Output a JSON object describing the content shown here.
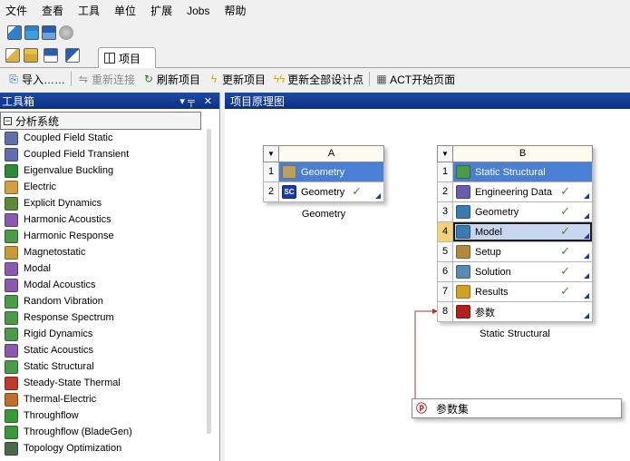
{
  "menubar": [
    "文件",
    "查看",
    "工具",
    "单位",
    "扩展",
    "Jobs",
    "帮助"
  ],
  "toolbar1": [
    {
      "icon": "new-project-icon",
      "color": "#2f7fd2"
    },
    {
      "icon": "open-project-icon",
      "color": "#d1a33a"
    },
    {
      "icon": "save-project-icon",
      "color": "#2a5db0"
    },
    {
      "icon": "archive-icon",
      "color": "#8d8d8d"
    }
  ],
  "tabs": {
    "project_label": "项目"
  },
  "toolbar2": {
    "import": "导入……",
    "reconnect": "重新连接",
    "refresh": "刷新项目",
    "update": "更新项目",
    "update_all": "更新全部设计点",
    "act": "ACT开始页面"
  },
  "toolbox": {
    "title": "工具箱",
    "pin": "▾ ╤",
    "close": "✕",
    "group": "分析系统",
    "items": [
      {
        "label": "Coupled Field Static",
        "color": "#5f6fb0"
      },
      {
        "label": "Coupled Field Transient",
        "color": "#5f6fb0"
      },
      {
        "label": "Eigenvalue Buckling",
        "color": "#2f8a3a"
      },
      {
        "label": "Electric",
        "color": "#d1a040"
      },
      {
        "label": "Explicit Dynamics",
        "color": "#5a8a3a"
      },
      {
        "label": "Harmonic Acoustics",
        "color": "#8a5ab0"
      },
      {
        "label": "Harmonic Response",
        "color": "#4a9a4a"
      },
      {
        "label": "Magnetostatic",
        "color": "#c89a3a"
      },
      {
        "label": "Modal",
        "color": "#8a5ab0"
      },
      {
        "label": "Modal Acoustics",
        "color": "#8a5ab0"
      },
      {
        "label": "Random Vibration",
        "color": "#4a9a4a"
      },
      {
        "label": "Response Spectrum",
        "color": "#4a9a4a"
      },
      {
        "label": "Rigid Dynamics",
        "color": "#4a9a4a"
      },
      {
        "label": "Static Acoustics",
        "color": "#8a5ab0"
      },
      {
        "label": "Static Structural",
        "color": "#4a9a4a"
      },
      {
        "label": "Steady-State Thermal",
        "color": "#c0392b"
      },
      {
        "label": "Thermal-Electric",
        "color": "#c0702b"
      },
      {
        "label": "Throughflow",
        "color": "#3a9a3a"
      },
      {
        "label": "Throughflow (BladeGen)",
        "color": "#3a9a3a"
      },
      {
        "label": "Topology Optimization",
        "color": "#4a6a4a"
      }
    ]
  },
  "schematic": {
    "title": "项目原理图",
    "system_a": {
      "letter": "A",
      "rows": [
        {
          "num": "1",
          "label": "Geometry",
          "icon": "geometry-system-icon",
          "color": "#b7a060",
          "title": true
        },
        {
          "num": "2",
          "label": "Geometry",
          "icon": "spaceclaim-icon",
          "icon_text": "SC",
          "color": "#1b3aa8",
          "check": true
        }
      ],
      "name": "Geometry"
    },
    "system_b": {
      "letter": "B",
      "rows": [
        {
          "num": "1",
          "label": "Static Structural",
          "icon": "static-structural-icon",
          "color": "#4a9a4a",
          "title": true
        },
        {
          "num": "2",
          "label": "Engineering Data",
          "icon": "engineering-data-icon",
          "color": "#6a5ab0",
          "check": true
        },
        {
          "num": "3",
          "label": "Geometry",
          "icon": "geometry-icon",
          "color": "#3a7ab0",
          "check": true
        },
        {
          "num": "4",
          "label": "Model",
          "icon": "model-icon",
          "color": "#3a7ab0",
          "check": true,
          "selected": true
        },
        {
          "num": "5",
          "label": "Setup",
          "icon": "setup-icon",
          "color": "#b08a3a",
          "check": true
        },
        {
          "num": "6",
          "label": "Solution",
          "icon": "solution-icon",
          "color": "#5a8ab0",
          "check": true
        },
        {
          "num": "7",
          "label": "Results",
          "icon": "results-icon",
          "color": "#d0a020",
          "check": true
        },
        {
          "num": "8",
          "label": "参数",
          "icon": "parameters-icon",
          "color": "#b02020"
        }
      ],
      "name": "Static Structural"
    },
    "parameter_set": "参数集"
  },
  "colors": {
    "panel_header": "#0a2f86",
    "title_cell": "#4a7fd6",
    "selected_cell": "#c9d6ef",
    "check": "#4f8a2a",
    "link_line": "#a33"
  }
}
